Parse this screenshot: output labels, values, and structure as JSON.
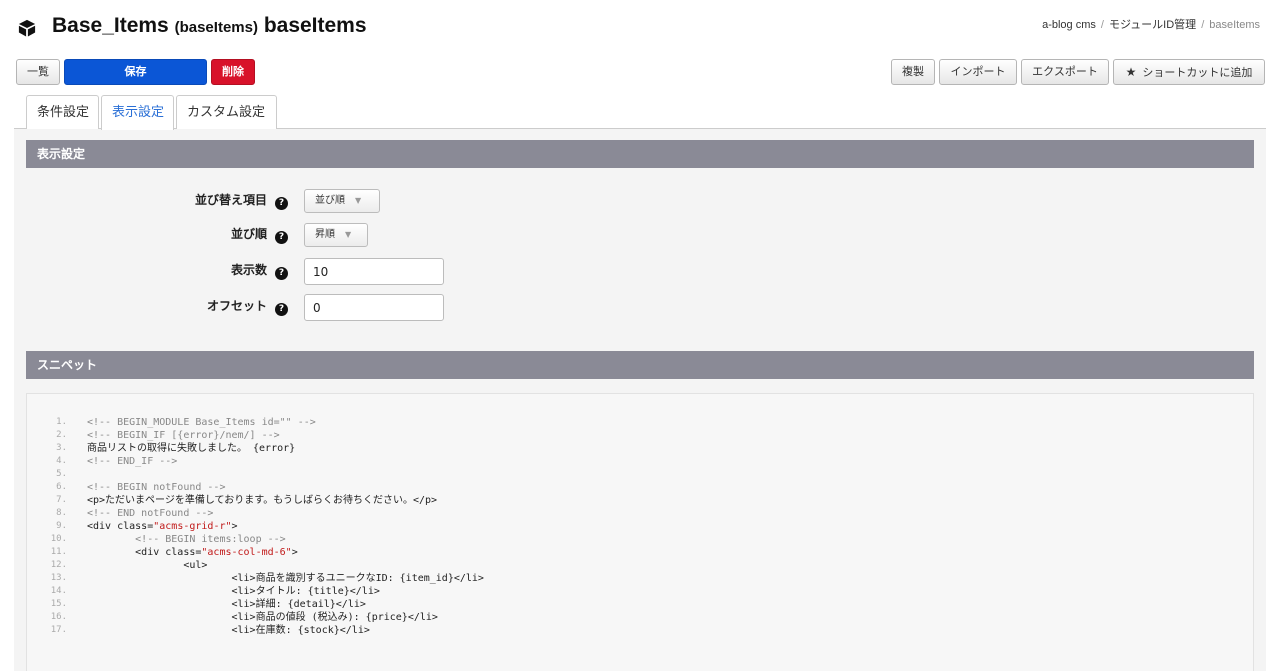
{
  "header": {
    "title_main": "Base_Items",
    "title_paren": "(baseItems)",
    "title_id": "baseItems",
    "breadcrumb": [
      "a-blog cms",
      "モジュールID管理",
      "baseItems"
    ]
  },
  "toolbar": {
    "list_label": "一覧",
    "save_label": "保存",
    "delete_label": "削除",
    "duplicate_label": "複製",
    "import_label": "インポート",
    "export_label": "エクスポート",
    "shortcut_label": "ショートカットに追加"
  },
  "tabs": [
    {
      "label": "条件設定",
      "active": false
    },
    {
      "label": "表示設定",
      "active": true
    },
    {
      "label": "カスタム設定",
      "active": false
    }
  ],
  "display_settings": {
    "heading": "表示設定",
    "sort_item_label": "並び替え項目",
    "sort_item_value": "並び順",
    "sort_order_label": "並び順",
    "sort_order_value": "昇順",
    "limit_label": "表示数",
    "limit_value": "10",
    "offset_label": "オフセット",
    "offset_value": "0"
  },
  "snippet": {
    "heading": "スニペット",
    "lines": [
      {
        "num": "1.",
        "text": "<!-- BEGIN_MODULE Base_Items id=\"\" -->"
      },
      {
        "num": "2.",
        "text": "<!-- BEGIN_IF [{error}/nem/] -->"
      },
      {
        "num": "3.",
        "text": "商品リストの取得に失敗しました。 {error}"
      },
      {
        "num": "4.",
        "text": "<!-- END_IF -->"
      },
      {
        "num": "5.",
        "text": ""
      },
      {
        "num": "6.",
        "text": "<!-- BEGIN notFound -->"
      },
      {
        "num": "7.",
        "text": "<p>ただいまページを準備しております。もうしばらくお待ちください。</p>"
      },
      {
        "num": "8.",
        "text": "<!-- END notFound -->"
      },
      {
        "num": "9.",
        "text": "<div class=\"acms-grid-r\">"
      },
      {
        "num": "10.",
        "text": "        <!-- BEGIN items:loop -->"
      },
      {
        "num": "11.",
        "text": "        <div class=\"acms-col-md-6\">"
      },
      {
        "num": "12.",
        "text": "                <ul>"
      },
      {
        "num": "13.",
        "text": "                        <li>商品を識別するユニークなID: {item_id}</li>"
      },
      {
        "num": "14.",
        "text": "                        <li>タイトル: {title}</li>"
      },
      {
        "num": "15.",
        "text": "                        <li>詳細: {detail}</li>"
      },
      {
        "num": "16.",
        "text": "                        <li>商品の値段 (税込み): {price}</li>"
      },
      {
        "num": "17.",
        "text": "                        <li>在庫数: {stock}</li>"
      }
    ]
  },
  "icons": {
    "logo": "cube-icon",
    "help": "question-circle-icon",
    "shortcut": "star-icon"
  },
  "colors": {
    "primary": "#0b56d6",
    "danger": "#d8122a",
    "section_header": "#8a8a96",
    "active_tab": "#2a6fd6"
  }
}
